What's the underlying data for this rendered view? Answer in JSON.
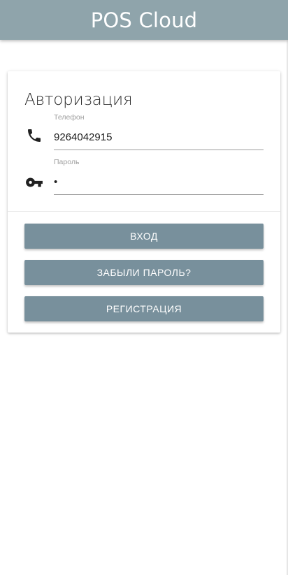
{
  "app": {
    "title": "POS Cloud",
    "header_color": "#8fa4ab"
  },
  "auth": {
    "title": "Авторизация",
    "phone": {
      "label": "Телефон",
      "value": "9264042915",
      "icon": "phone-icon"
    },
    "password": {
      "label": "Пароль",
      "value": "•",
      "icon": "key-icon"
    }
  },
  "buttons": {
    "login": "ВХОД",
    "forgot": "ЗАБЫЛИ ПАРОЛЬ?",
    "register": "РЕГИСТРАЦИЯ",
    "color": "#78909c"
  }
}
